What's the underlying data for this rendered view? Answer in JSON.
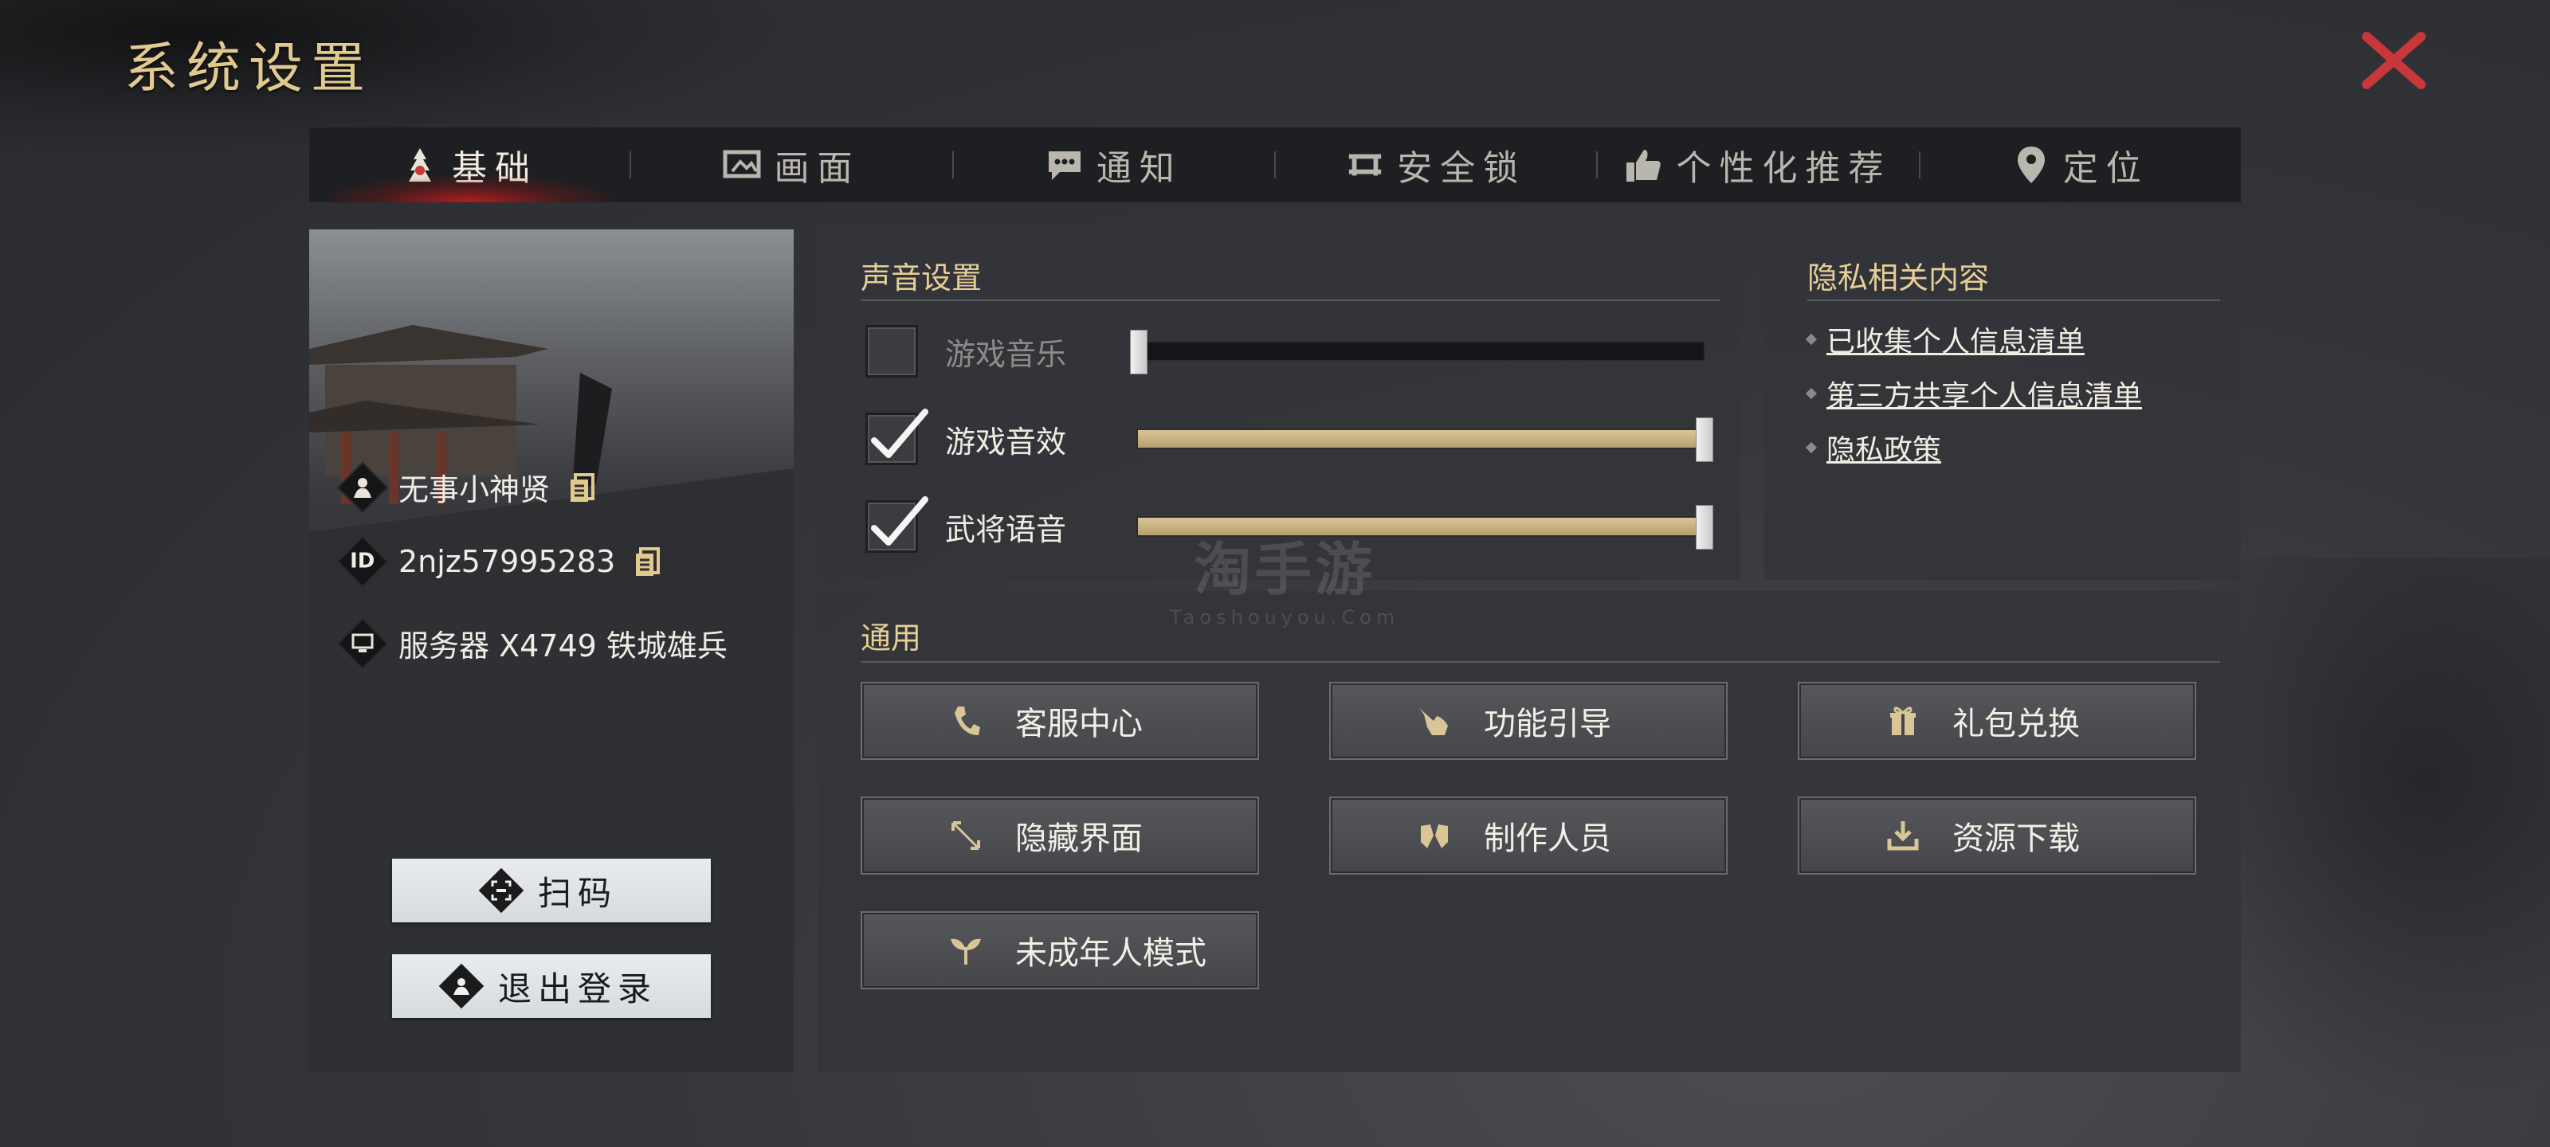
{
  "window": {
    "title": "系统设置"
  },
  "tabs": [
    {
      "label": "基础",
      "icon": "tower-icon",
      "active": true
    },
    {
      "label": "画面",
      "icon": "screen-icon",
      "active": false
    },
    {
      "label": "通知",
      "icon": "chat-icon",
      "active": false
    },
    {
      "label": "安全锁",
      "icon": "lock-bench-icon",
      "active": false
    },
    {
      "label": "个性化推荐",
      "icon": "thumbs-up-icon",
      "active": false
    },
    {
      "label": "定位",
      "icon": "location-pin-icon",
      "active": false
    }
  ],
  "user": {
    "name": "无事小神贤",
    "id_label": "ID",
    "id": "2njz57995283",
    "server": "服务器 X4749 铁城雄兵"
  },
  "left_buttons": {
    "scan": "扫码",
    "logout": "退出登录"
  },
  "sound": {
    "title": "声音设置",
    "rows": [
      {
        "label": "游戏音乐",
        "checked": false,
        "level": 0.0
      },
      {
        "label": "游戏音效",
        "checked": true,
        "level": 1.0
      },
      {
        "label": "武将语音",
        "checked": true,
        "level": 1.0
      }
    ]
  },
  "privacy": {
    "title": "隐私相关内容",
    "links": [
      "已收集个人信息清单",
      "第三方共享个人信息清单",
      "隐私政策"
    ]
  },
  "general": {
    "title": "通用",
    "buttons": [
      {
        "label": "客服中心",
        "icon": "phone-icon"
      },
      {
        "label": "功能引导",
        "icon": "pointing-hand-icon"
      },
      {
        "label": "礼包兑换",
        "icon": "gift-icon"
      },
      {
        "label": "隐藏界面",
        "icon": "expand-arrows-icon"
      },
      {
        "label": "制作人员",
        "icon": "hands-icon"
      },
      {
        "label": "资源下载",
        "icon": "download-icon"
      },
      {
        "label": "未成年人模式",
        "icon": "sprout-icon"
      }
    ]
  },
  "watermark": {
    "line1": "淘手游",
    "line2": "Taoshouyou.Com"
  },
  "colors": {
    "accent_gold": "#e6cf96",
    "close_red": "#c8373a",
    "slider_fill": "#c9b382"
  }
}
